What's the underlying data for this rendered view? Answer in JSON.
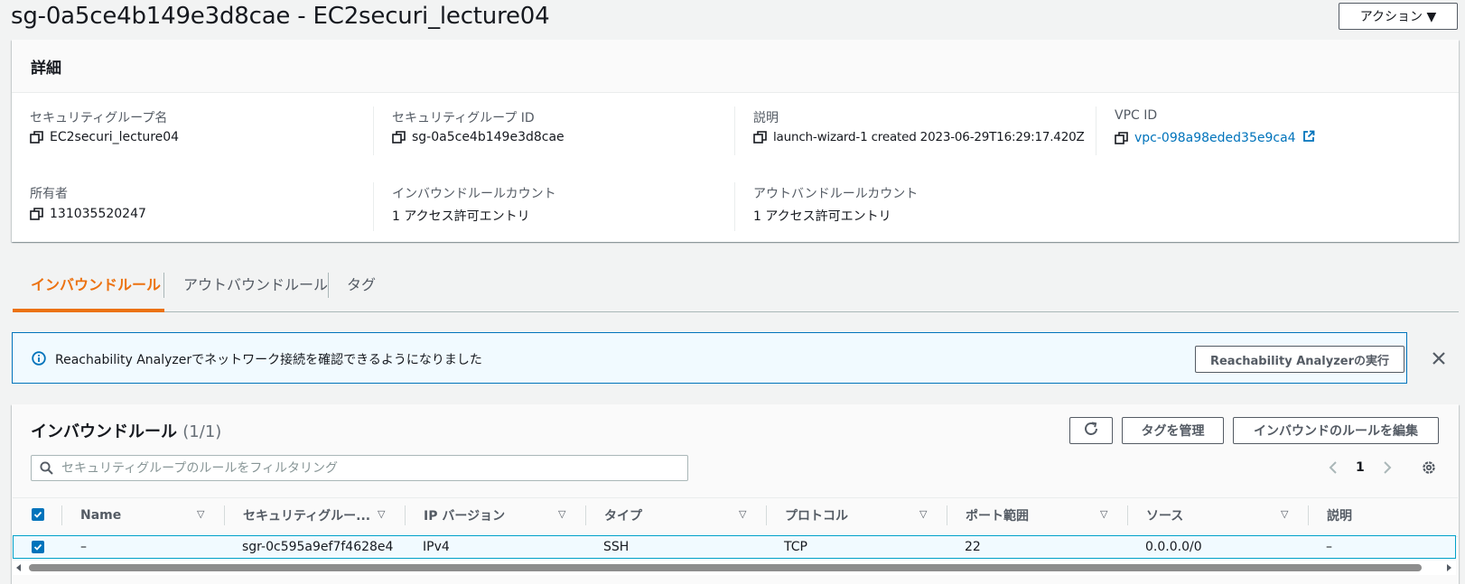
{
  "page": {
    "title": "sg-0a5ce4b149e3d8cae - EC2securi_lecture04",
    "actions_label": "アクション ▼"
  },
  "details": {
    "heading": "詳細",
    "fields": [
      {
        "label": "セキュリティグループ名",
        "value": "EC2securi_lecture04"
      },
      {
        "label": "セキュリティグループ ID",
        "value": "sg-0a5ce4b149e3d8cae"
      },
      {
        "label": "説明",
        "value": "launch-wizard-1 created 2023-06-29T16:29:17.420Z"
      },
      {
        "label": "VPC ID",
        "value": "vpc-098a98eded35e9ca4"
      },
      {
        "label": "所有者",
        "value": "131035520247"
      },
      {
        "label": "インバウンドルールカウント",
        "value": "1 アクセス許可エントリ"
      },
      {
        "label": "アウトバンドルールカウント",
        "value": "1 アクセス許可エントリ"
      }
    ]
  },
  "tabs": [
    {
      "label": "インバウンドルール",
      "active": true
    },
    {
      "label": "アウトバウンドルール",
      "active": false
    },
    {
      "label": "タグ",
      "active": false
    }
  ],
  "info_banner": {
    "message": "Reachability Analyzerでネットワーク接続を確認できるようになりました",
    "button_label": "Reachability Analyzerの実行"
  },
  "rules_panel": {
    "title": "インバウンドルール",
    "count": "(1/1)",
    "manage_tags_label": "タグを管理",
    "edit_rules_label": "インバウンドのルールを編集",
    "search_placeholder": "セキュリティグループのルールをフィルタリング",
    "page_number": "1",
    "columns": [
      "Name",
      "セキュリティグルー...",
      "IP バージョン",
      "タイプ",
      "プロトコル",
      "ポート範囲",
      "ソース",
      "説明"
    ],
    "rows": [
      {
        "name": "–",
        "rule_id": "sgr-0c595a9ef7f4628e4",
        "ip_version": "IPv4",
        "type": "SSH",
        "protocol": "TCP",
        "port_range": "22",
        "source": "0.0.0.0/0",
        "description": "–"
      }
    ]
  },
  "colors": {
    "accent_orange": "#ec7211",
    "link_blue": "#0073bb",
    "info_bg": "#f1faff"
  }
}
